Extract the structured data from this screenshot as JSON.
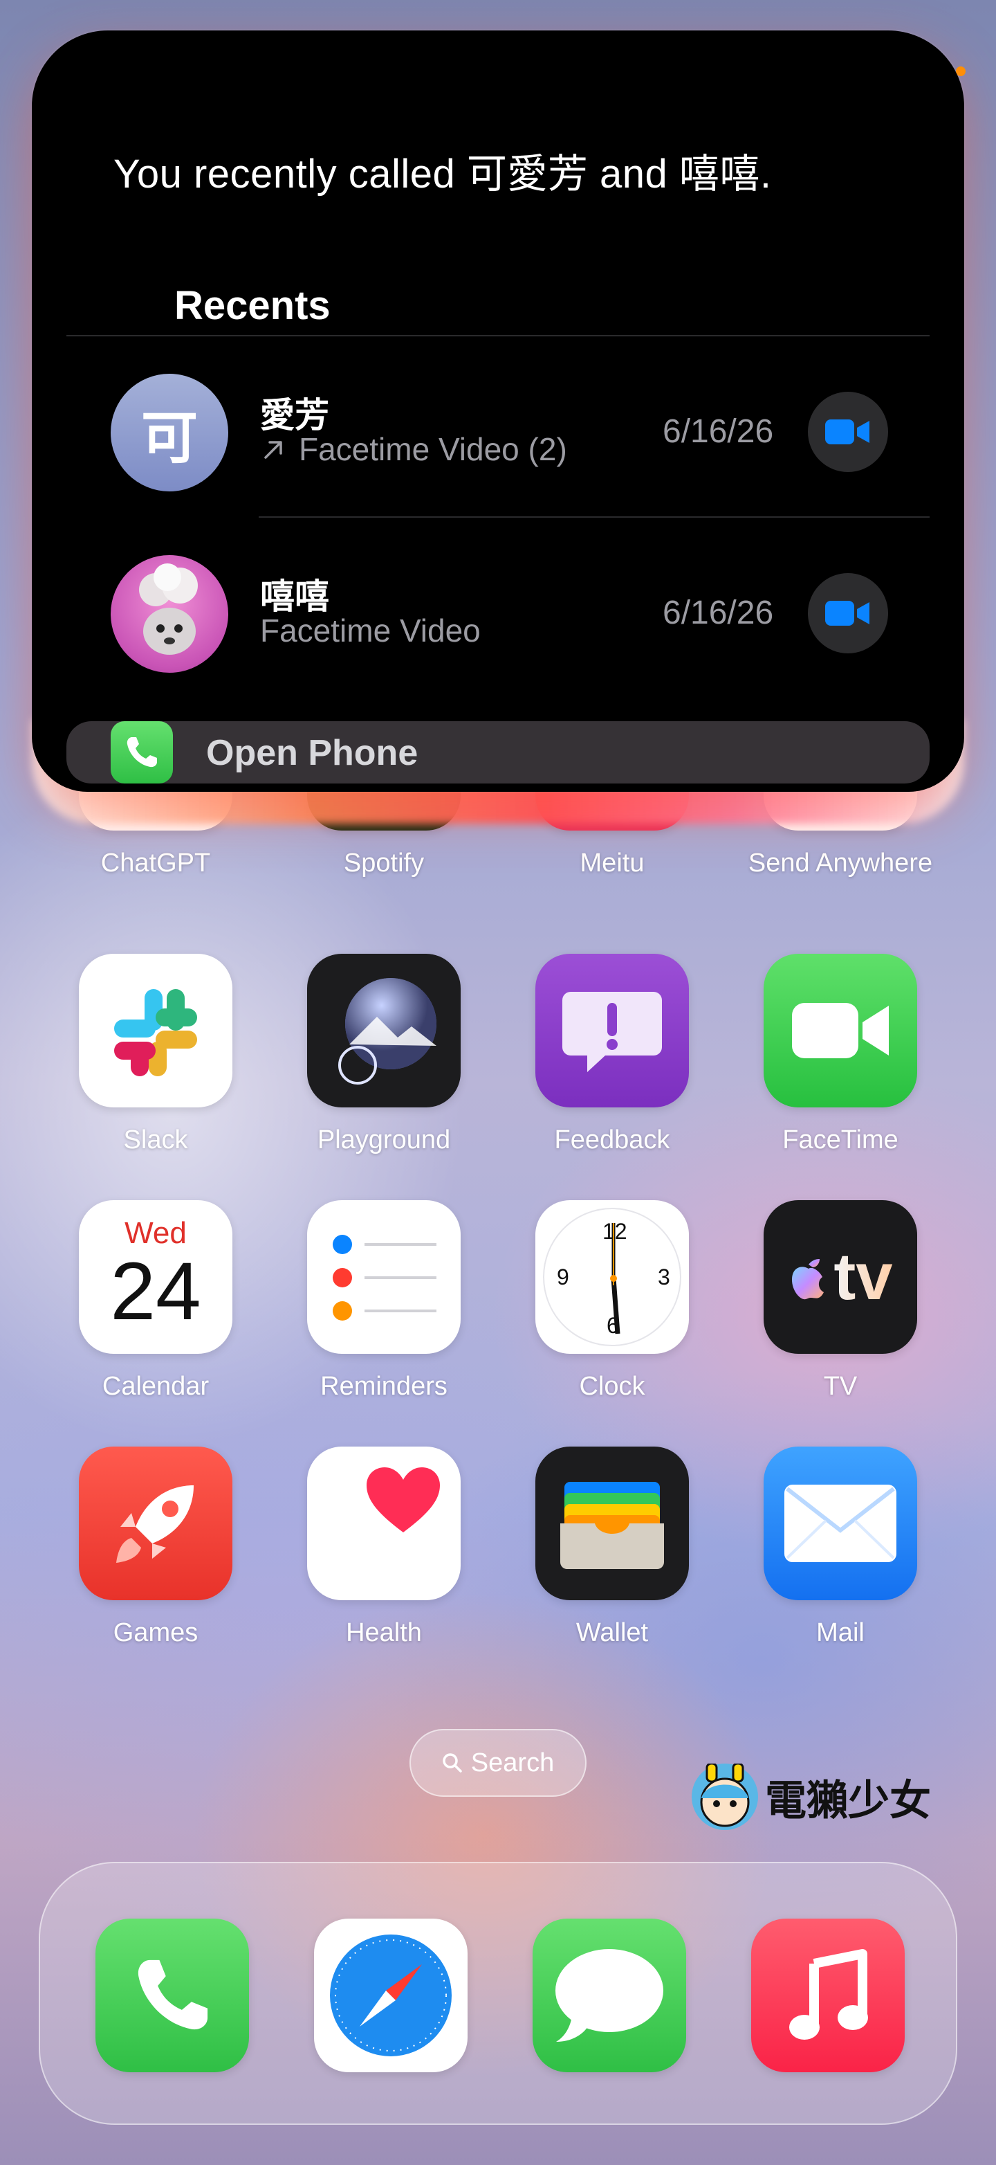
{
  "siri": {
    "message": "You recently called 可愛芳 and 嘻嘻.",
    "section_title": "Recents"
  },
  "recents": [
    {
      "avatar_text": "可",
      "name": "愛芳",
      "direction_icon": "outgoing-arrow-icon",
      "detail": "Facetime Video (2)",
      "date": "6/16/26"
    },
    {
      "avatar_text": "",
      "name": "嘻嘻",
      "direction_icon": "",
      "detail": "Facetime Video",
      "date": "6/16/26"
    }
  ],
  "open_phone": {
    "label": "Open Phone"
  },
  "apps": {
    "row1": [
      "ChatGPT",
      "Spotify",
      "Meitu",
      "Send Anywhere"
    ],
    "row2": [
      "Slack",
      "Playground",
      "Feedback",
      "FaceTime"
    ],
    "row3": [
      "Calendar",
      "Reminders",
      "Clock",
      "TV"
    ],
    "row4": [
      "Games",
      "Health",
      "Wallet",
      "Mail"
    ]
  },
  "calendar": {
    "weekday": "Wed",
    "day": "24"
  },
  "clock_numerals": [
    "12",
    "3",
    "6",
    "9"
  ],
  "tv_text": "tv",
  "search": {
    "label": "Search"
  },
  "watermark": {
    "text": "電獺少女"
  },
  "dock": [
    "Phone",
    "Safari",
    "Messages",
    "Music"
  ],
  "colors": {
    "facetime_blue": "#0a84ff",
    "phone_green": "#34c759",
    "status_orange": "#ff9500"
  }
}
